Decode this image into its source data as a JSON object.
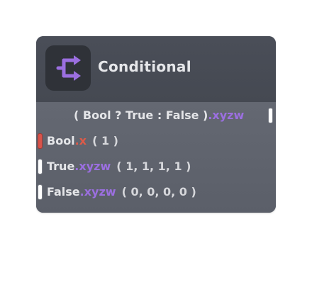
{
  "node": {
    "title": "Conditional",
    "icon": "conditional-branch-icon",
    "accent_color": "#9b6fe0",
    "output": {
      "label": "( Bool ? True : False )",
      "swizzle": ".xyzw"
    },
    "inputs": [
      {
        "name": "Bool",
        "swizzle": ".x",
        "default": "( 1 )",
        "port_color": "#d9534a"
      },
      {
        "name": "True",
        "swizzle": ".xyzw",
        "default": "( 1, 1, 1, 1 )",
        "port_color": "#ffffff"
      },
      {
        "name": "False",
        "swizzle": ".xyzw",
        "default": "( 0, 0, 0, 0 )",
        "port_color": "#ffffff"
      }
    ]
  }
}
